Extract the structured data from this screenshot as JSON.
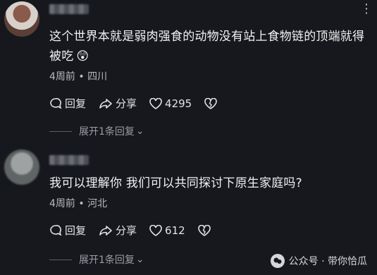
{
  "comments": [
    {
      "text": "这个世界本就是弱肉强食的动物没有站上食物链的顶端就得被吃",
      "emoji": "😲",
      "meta": "4周前 • 四川",
      "reply_label": "回复",
      "share_label": "分享",
      "likes": "4295",
      "expand_label": "展开1条回复"
    },
    {
      "text": "我可以理解你 我们可以共同探讨下原生家庭吗?",
      "meta": "4周前 • 河北",
      "reply_label": "回复",
      "share_label": "分享",
      "likes": "612",
      "expand_label": "展开1条回复"
    }
  ],
  "watermark": "公众号 · 带你恰瓜",
  "colors": {
    "background": "#16181d",
    "text": "#f0f1f3",
    "muted": "#9a9da3"
  }
}
